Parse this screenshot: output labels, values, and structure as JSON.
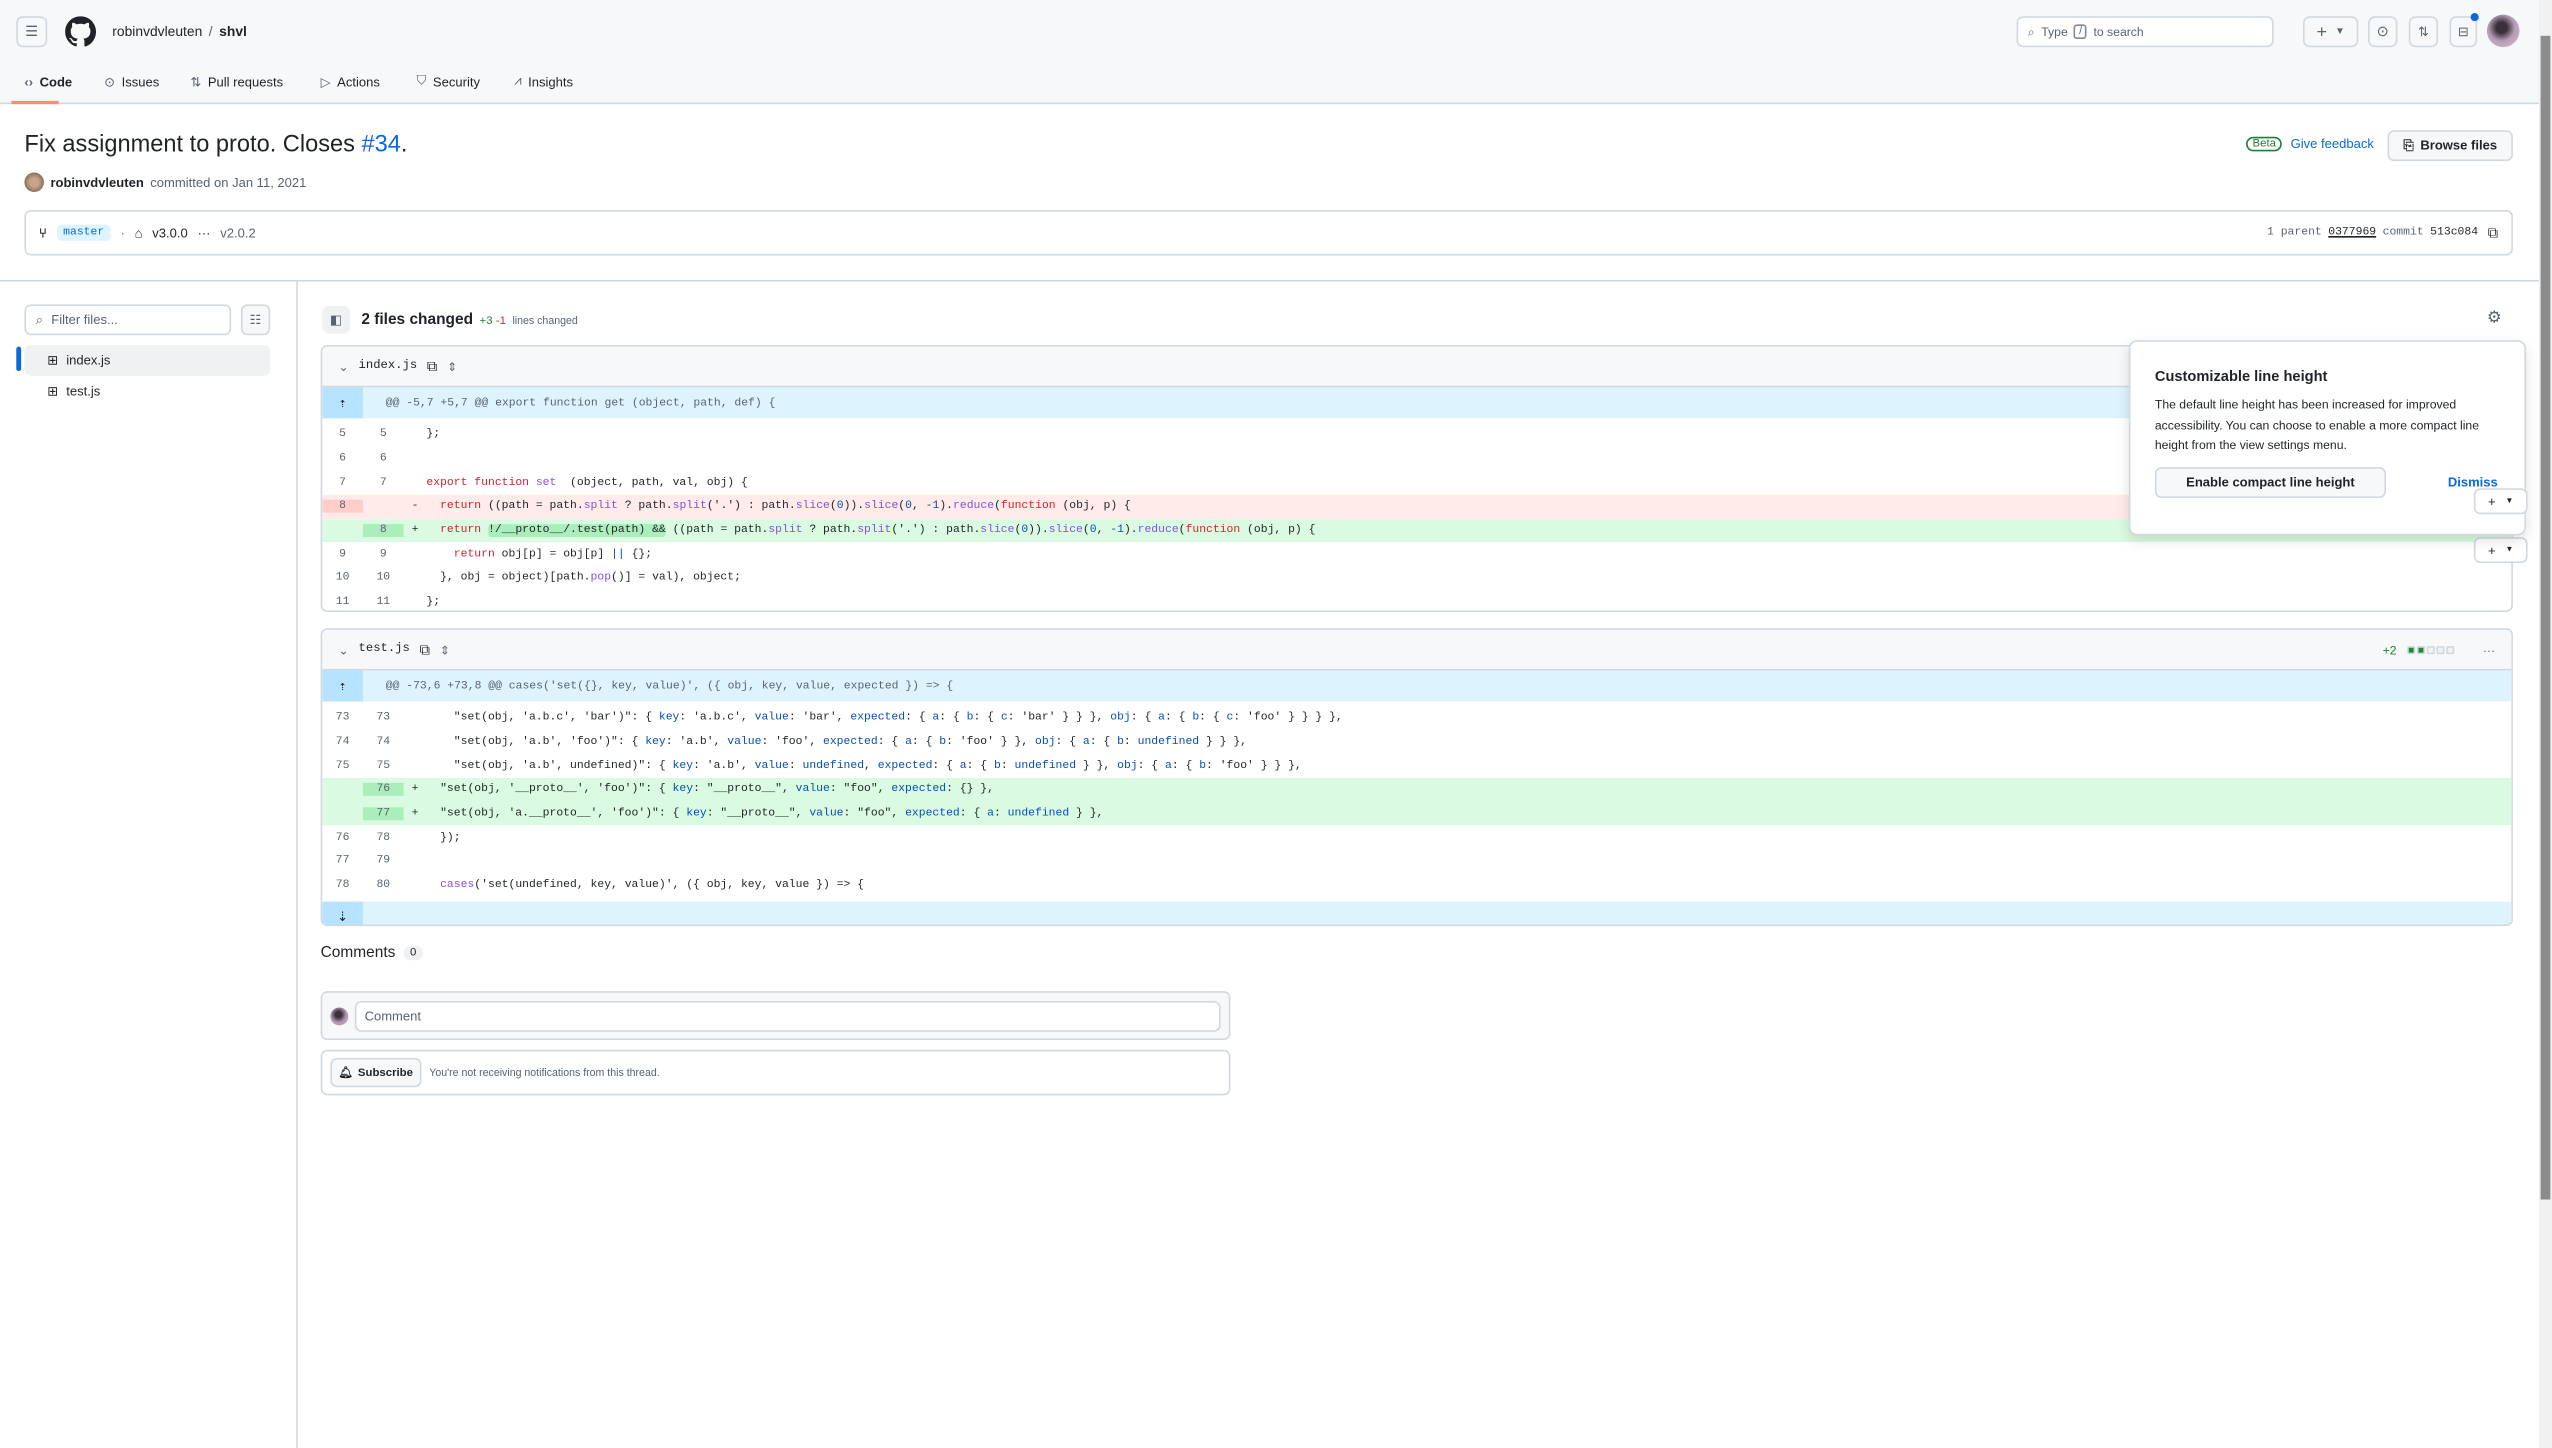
{
  "header": {
    "owner": "robinvdvleuten",
    "separator": "/",
    "repo": "shvl",
    "search_prefix": "Type",
    "search_key": "/",
    "search_suffix": "to search"
  },
  "tabs": [
    {
      "label": "Code",
      "icon": "code-icon"
    },
    {
      "label": "Issues",
      "icon": "issue-icon"
    },
    {
      "label": "Pull requests",
      "icon": "pull-request-icon"
    },
    {
      "label": "Actions",
      "icon": "play-icon"
    },
    {
      "label": "Security",
      "icon": "shield-icon"
    },
    {
      "label": "Insights",
      "icon": "graph-icon"
    }
  ],
  "commit": {
    "title": "Fix assignment to proto. Closes ",
    "issue_link": "#34",
    "title_end": ".",
    "author": "robinvdvleuten",
    "committed": "committed on Jan 11, 2021",
    "branch": "master",
    "tag": "v3.0.0",
    "tag_ellipsis": "···",
    "tag_old": "v2.0.2",
    "parent_label": "1 parent",
    "parent_sha": "0377969",
    "commit_label": "commit",
    "commit_sha": "513c084",
    "beta": "Beta",
    "feedback": "Give feedback",
    "browse": "Browse files"
  },
  "sidebar": {
    "filter_placeholder": "Filter files...",
    "files": [
      "index.js",
      "test.js"
    ]
  },
  "summary": {
    "files_changed": "2 files changed",
    "additions": "+3",
    "deletions": "-1",
    "lines_changed": "lines changed"
  },
  "colors": {
    "accent": "#0969da",
    "added": "#1a7f37",
    "deleted": "#d1242f",
    "tab_underline": "#fd8c73"
  },
  "files": [
    {
      "name": "index.js",
      "hunk": "@@ -5,7 +5,7 @@ export function get (object, path, def) {",
      "lines": [
        {
          "o": "5",
          "n": "5",
          "t": "",
          "c": [
            "};"
          ]
        },
        {
          "o": "6",
          "n": "6",
          "t": "",
          "c": [
            ""
          ]
        },
        {
          "o": "7",
          "n": "7",
          "t": "",
          "c": [
            [
              "k",
              "export"
            ],
            " ",
            [
              "k",
              "function"
            ],
            " ",
            [
              "f",
              "set"
            ],
            "  (object, path, val, obj) {"
          ]
        },
        {
          "o": "8",
          "n": "",
          "t": "del",
          "m": "-",
          "c": [
            "  ",
            [
              "k",
              "return"
            ],
            " ((path = path.",
            [
              "f",
              "split"
            ],
            " ? path.",
            [
              "f",
              "split"
            ],
            "('.') : path.",
            [
              "f",
              "slice"
            ],
            "(",
            [
              "p",
              "0"
            ],
            ")).",
            [
              "f",
              "slice"
            ],
            "(",
            [
              "p",
              "0"
            ],
            ", ",
            [
              "p",
              "-1"
            ],
            ").",
            [
              "f",
              "reduce"
            ],
            "(",
            [
              "k",
              "function"
            ],
            " (obj, p) {"
          ]
        },
        {
          "o": "",
          "n": "8",
          "t": "add",
          "m": "+",
          "c": [
            "  ",
            [
              "k",
              "return"
            ],
            " ",
            [
              "hl",
              "!/__proto__/.test(path) &&"
            ],
            " ((path = path.",
            [
              "f",
              "split"
            ],
            " ? path.",
            [
              "f",
              "split"
            ],
            "('.') : path.",
            [
              "f",
              "slice"
            ],
            "(",
            [
              "p",
              "0"
            ],
            ")).",
            [
              "f",
              "slice"
            ],
            "(",
            [
              "p",
              "0"
            ],
            ", ",
            [
              "p",
              "-1"
            ],
            ").",
            [
              "f",
              "reduce"
            ],
            "(",
            [
              "k",
              "function"
            ],
            " (obj, p) {"
          ]
        },
        {
          "o": "9",
          "n": "9",
          "t": "",
          "c": [
            "    ",
            [
              "k",
              "return"
            ],
            " obj[p] = obj[p] ",
            [
              "p",
              "||"
            ],
            " {};"
          ]
        },
        {
          "o": "10",
          "n": "10",
          "t": "",
          "c": [
            "  }, obj = object)[path.",
            [
              "f",
              "pop"
            ],
            "()] = val), object;"
          ]
        },
        {
          "o": "11",
          "n": "11",
          "t": "",
          "c": [
            "};"
          ]
        }
      ]
    },
    {
      "name": "test.js",
      "stat": "+2",
      "stat_blocks": {
        "added": 2,
        "deleted": 0,
        "neutral": 3
      },
      "hunk": "@@ -73,6 +73,8 @@ cases('set({}, key, value)', ({ obj, key, value, expected }) => {",
      "lines": [
        {
          "o": "73",
          "n": "73",
          "t": "",
          "c": [
            "    \"set(obj, 'a.b.c', 'bar')\": { ",
            [
              "p",
              "key"
            ],
            ": 'a.b.c', ",
            [
              "p",
              "value"
            ],
            ": 'bar', ",
            [
              "p",
              "expected"
            ],
            ": { ",
            [
              "p",
              "a"
            ],
            ": { ",
            [
              "p",
              "b"
            ],
            ": { ",
            [
              "p",
              "c"
            ],
            ": 'bar' } } }, ",
            [
              "p",
              "obj"
            ],
            ": { ",
            [
              "p",
              "a"
            ],
            ": { ",
            [
              "p",
              "b"
            ],
            ": { ",
            [
              "p",
              "c"
            ],
            ": 'foo' } } } },"
          ]
        },
        {
          "o": "74",
          "n": "74",
          "t": "",
          "c": [
            "    \"set(obj, 'a.b', 'foo')\": { ",
            [
              "p",
              "key"
            ],
            ": 'a.b', ",
            [
              "p",
              "value"
            ],
            ": 'foo', ",
            [
              "p",
              "expected"
            ],
            ": { ",
            [
              "p",
              "a"
            ],
            ": { ",
            [
              "p",
              "b"
            ],
            ": 'foo' } }, ",
            [
              "p",
              "obj"
            ],
            ": { ",
            [
              "p",
              "a"
            ],
            ": { ",
            [
              "p",
              "b"
            ],
            ": ",
            [
              "p",
              "undefined"
            ],
            " } } },"
          ]
        },
        {
          "o": "75",
          "n": "75",
          "t": "",
          "c": [
            "    \"set(obj, 'a.b', undefined)\": { ",
            [
              "p",
              "key"
            ],
            ": 'a.b', ",
            [
              "p",
              "value"
            ],
            ": ",
            [
              "p",
              "undefined"
            ],
            ", ",
            [
              "p",
              "expected"
            ],
            ": { ",
            [
              "p",
              "a"
            ],
            ": { ",
            [
              "p",
              "b"
            ],
            ": ",
            [
              "p",
              "undefined"
            ],
            " } }, ",
            [
              "p",
              "obj"
            ],
            ": { ",
            [
              "p",
              "a"
            ],
            ": { ",
            [
              "p",
              "b"
            ],
            ": 'foo' } } },"
          ]
        },
        {
          "o": "",
          "n": "76",
          "t": "add",
          "m": "+",
          "c": [
            "  \"set(obj, '__proto__', 'foo')\": { ",
            [
              "p",
              "key"
            ],
            ": \"__proto__\", ",
            [
              "p",
              "value"
            ],
            ": \"foo\", ",
            [
              "p",
              "expected"
            ],
            ": {} },"
          ]
        },
        {
          "o": "",
          "n": "77",
          "t": "add",
          "m": "+",
          "c": [
            "  \"set(obj, 'a.__proto__', 'foo')\": { ",
            [
              "p",
              "key"
            ],
            ": \"__proto__\", ",
            [
              "p",
              "value"
            ],
            ": \"foo\", ",
            [
              "p",
              "expected"
            ],
            ": { ",
            [
              "p",
              "a"
            ],
            ": ",
            [
              "p",
              "undefined"
            ],
            " } },"
          ]
        },
        {
          "o": "76",
          "n": "78",
          "t": "",
          "c": [
            "  });"
          ]
        },
        {
          "o": "77",
          "n": "79",
          "t": "",
          "c": [
            ""
          ]
        },
        {
          "o": "78",
          "n": "80",
          "t": "",
          "c": [
            "  ",
            [
              "f",
              "cases"
            ],
            "('set(undefined, key, value)', ({ obj, key, value }) => {"
          ]
        }
      ]
    }
  ],
  "comments": {
    "title": "Comments",
    "count": "0",
    "placeholder": "Comment",
    "subscribe": "Subscribe",
    "notice": "You're not receiving notifications from this thread."
  },
  "popover": {
    "title": "Customizable line height",
    "body": "The default line height has been increased for improved accessibility. You can choose to enable a more compact line height from the view settings menu.",
    "enable": "Enable compact line height",
    "dismiss": "Dismiss"
  }
}
